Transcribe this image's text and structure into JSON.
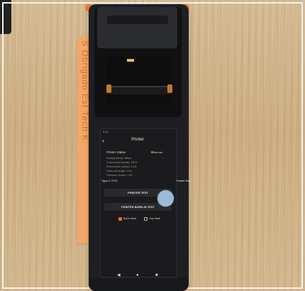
{
  "photo": {
    "tape_text": "S Obrigado Est Tech K"
  },
  "device_screen": {
    "status_bar_time": "9:41",
    "back_icon": "‹",
    "title": "Printer",
    "printer_status_label": "Printer Status",
    "printer_status_value": "Normal",
    "info_lines": [
      "Receipt format: 58mm",
      "Current print density: 100%",
      "Print service version: 3.3.8",
      "Total print length: 0.0m",
      "Firmware version: 1.00"
    ],
    "printer_test_button": "PRINTER TEST",
    "burn_in_test_button": "PRINTER BURN-IN TEST",
    "checkbox_black_mark": "Black Mark",
    "checkbox_gap_mark": "Gap Mark",
    "power_key_label": "Power Key",
    "side_text": "Type-C OTG",
    "nav_back": "◀",
    "nav_home": "●",
    "nav_recent": "■"
  }
}
